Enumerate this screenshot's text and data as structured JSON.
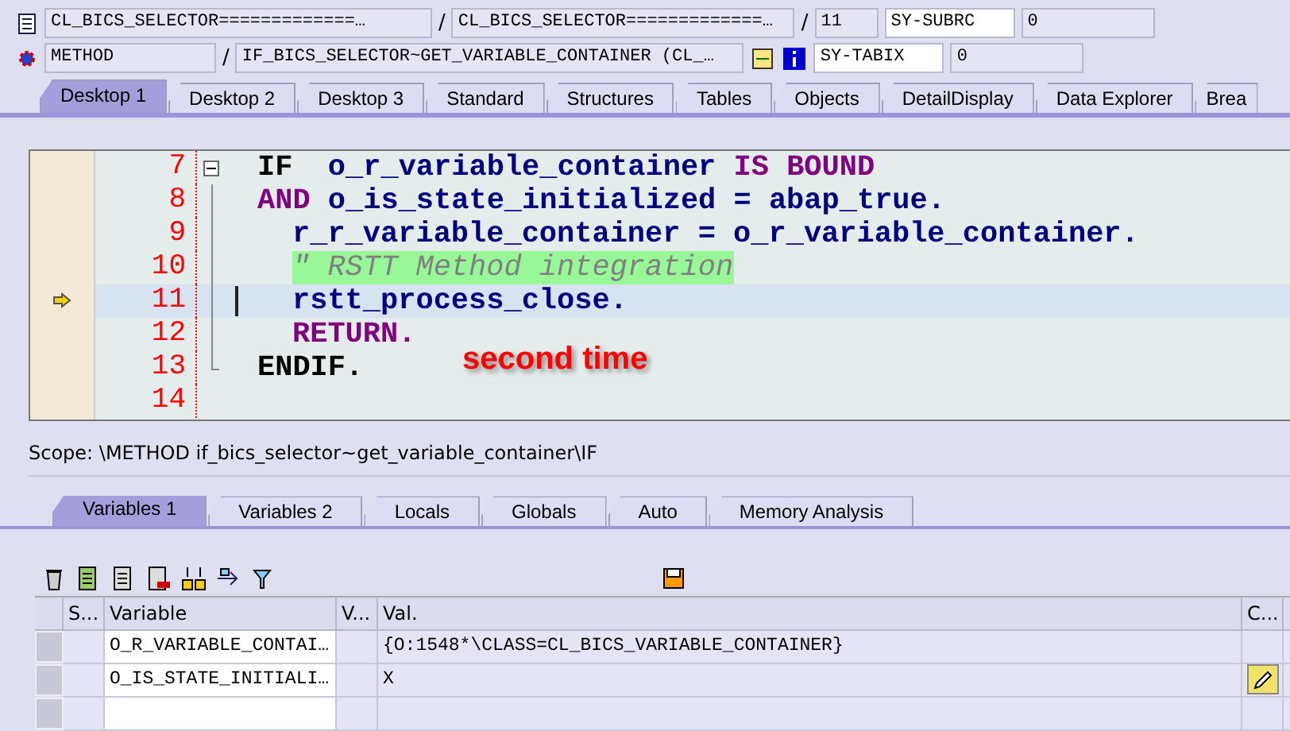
{
  "header": {
    "row1": {
      "field1": "CL_BICS_SELECTOR=============…",
      "field2": "CL_BICS_SELECTOR=============…",
      "field3": "11",
      "sys_name": "SY-SUBRC",
      "sys_value": "0"
    },
    "row2": {
      "field1": "METHOD",
      "field2": "IF_BICS_SELECTOR~GET_VARIABLE_CONTAINER (CL_…",
      "sys_name": "SY-TABIX",
      "sys_value": "0"
    },
    "separator": "/"
  },
  "desktop_tabs": [
    {
      "label": "Desktop 1",
      "selected": true
    },
    {
      "label": "Desktop 2",
      "selected": false
    },
    {
      "label": "Desktop 3",
      "selected": false
    },
    {
      "label": "Standard",
      "selected": false
    },
    {
      "label": "Structures",
      "selected": false
    },
    {
      "label": "Tables",
      "selected": false
    },
    {
      "label": "Objects",
      "selected": false
    },
    {
      "label": "DetailDisplay",
      "selected": false
    },
    {
      "label": "Data Explorer",
      "selected": false
    },
    {
      "label": "Brea",
      "selected": false
    }
  ],
  "code": {
    "lines": [
      {
        "number": "7",
        "current": false,
        "tokens": [
          {
            "kind": "stmt",
            "text": "IF"
          },
          {
            "kind": "ident",
            "text": "  o_r_variable_container "
          },
          {
            "kind": "keyword",
            "text": "IS BOUND"
          }
        ]
      },
      {
        "number": "8",
        "current": false,
        "tokens": [
          {
            "kind": "keyword",
            "text": "AND"
          },
          {
            "kind": "ident",
            "text": " o_is_state_initialized = abap_true."
          }
        ],
        "children": [
          {
            "number": "9",
            "current": false,
            "tokens": [
              {
                "kind": "ident",
                "text": "r_r_variable_container = o_r_variable_container."
              }
            ]
          },
          {
            "number": "10",
            "current": false,
            "tokens": [
              {
                "kind": "comment",
                "text": "\" RSTT Method integration"
              }
            ]
          },
          {
            "number": "11",
            "current": true,
            "tokens": [
              {
                "kind": "ident",
                "text": "rstt_process_close."
              }
            ]
          },
          {
            "number": "12",
            "current": false,
            "tokens": [
              {
                "kind": "keyword",
                "text": "RETURN."
              }
            ]
          }
        ]
      },
      {
        "number": "13",
        "current": false,
        "tokens": [
          {
            "kind": "stmt",
            "text": "ENDIF."
          }
        ]
      },
      {
        "number": "14",
        "current": false
      }
    ],
    "annotation": "second time"
  },
  "scope": "Scope: \\METHOD if_bics_selector~get_variable_container\\IF",
  "variable_tabs": [
    {
      "label": "Variables 1",
      "selected": true
    },
    {
      "label": "Variables 2",
      "selected": false
    },
    {
      "label": "Locals",
      "selected": false
    },
    {
      "label": "Globals",
      "selected": false
    },
    {
      "label": "Auto",
      "selected": false
    },
    {
      "label": "Memory Analysis",
      "selected": false
    }
  ],
  "table": {
    "columns": [
      "S...",
      "Variable",
      "V...",
      "Val.",
      "C..."
    ],
    "rows": [
      {
        "variable": "O_R_VARIABLE_CONTAI…",
        "value": "{O:1548*\\CLASS=CL_BICS_VARIABLE_CONTAINER}",
        "editable": false
      },
      {
        "variable": "O_IS_STATE_INITIALI…",
        "value": "X",
        "editable": true
      }
    ]
  }
}
